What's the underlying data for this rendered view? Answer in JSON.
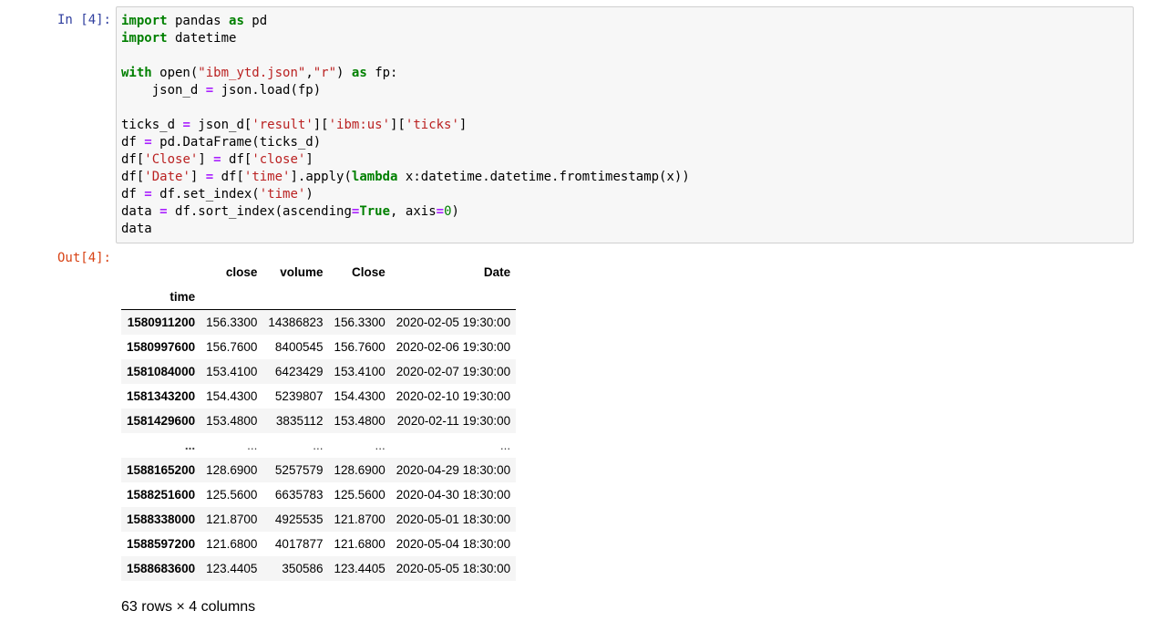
{
  "input_cell": {
    "prompt": "In [4]:",
    "code_lines": [
      [
        {
          "t": "import",
          "c": "kw"
        },
        {
          "t": " pandas ",
          "c": "n"
        },
        {
          "t": "as",
          "c": "kw"
        },
        {
          "t": " pd",
          "c": "n"
        }
      ],
      [
        {
          "t": "import",
          "c": "kw"
        },
        {
          "t": " datetime",
          "c": "n"
        }
      ],
      [],
      [
        {
          "t": "with",
          "c": "kw"
        },
        {
          "t": " open(",
          "c": "n"
        },
        {
          "t": "\"ibm_ytd.json\"",
          "c": "st"
        },
        {
          "t": ",",
          "c": "n"
        },
        {
          "t": "\"r\"",
          "c": "st"
        },
        {
          "t": ") ",
          "c": "n"
        },
        {
          "t": "as",
          "c": "kw"
        },
        {
          "t": " fp:",
          "c": "n"
        }
      ],
      [
        {
          "t": "    json_d ",
          "c": "n"
        },
        {
          "t": "=",
          "c": "op"
        },
        {
          "t": " json.load(fp)",
          "c": "n"
        }
      ],
      [],
      [
        {
          "t": "ticks_d ",
          "c": "n"
        },
        {
          "t": "=",
          "c": "op"
        },
        {
          "t": " json_d[",
          "c": "n"
        },
        {
          "t": "'result'",
          "c": "st"
        },
        {
          "t": "][",
          "c": "n"
        },
        {
          "t": "'ibm:us'",
          "c": "st"
        },
        {
          "t": "][",
          "c": "n"
        },
        {
          "t": "'ticks'",
          "c": "st"
        },
        {
          "t": "]",
          "c": "n"
        }
      ],
      [
        {
          "t": "df ",
          "c": "n"
        },
        {
          "t": "=",
          "c": "op"
        },
        {
          "t": " pd.DataFrame(ticks_d)",
          "c": "n"
        }
      ],
      [
        {
          "t": "df[",
          "c": "n"
        },
        {
          "t": "'Close'",
          "c": "st"
        },
        {
          "t": "] ",
          "c": "n"
        },
        {
          "t": "=",
          "c": "op"
        },
        {
          "t": " df[",
          "c": "n"
        },
        {
          "t": "'close'",
          "c": "st"
        },
        {
          "t": "]",
          "c": "n"
        }
      ],
      [
        {
          "t": "df[",
          "c": "n"
        },
        {
          "t": "'Date'",
          "c": "st"
        },
        {
          "t": "] ",
          "c": "n"
        },
        {
          "t": "=",
          "c": "op"
        },
        {
          "t": " df[",
          "c": "n"
        },
        {
          "t": "'time'",
          "c": "st"
        },
        {
          "t": "].apply(",
          "c": "n"
        },
        {
          "t": "lambda",
          "c": "kw"
        },
        {
          "t": " x:datetime.datetime.fromtimestamp(x))",
          "c": "n"
        }
      ],
      [
        {
          "t": "df ",
          "c": "n"
        },
        {
          "t": "=",
          "c": "op"
        },
        {
          "t": " df.set_index(",
          "c": "n"
        },
        {
          "t": "'time'",
          "c": "st"
        },
        {
          "t": ")",
          "c": "n"
        }
      ],
      [
        {
          "t": "data ",
          "c": "n"
        },
        {
          "t": "=",
          "c": "op"
        },
        {
          "t": " df.sort_index(ascending",
          "c": "n"
        },
        {
          "t": "=",
          "c": "op"
        },
        {
          "t": "True",
          "c": "kw"
        },
        {
          "t": ", axis",
          "c": "n"
        },
        {
          "t": "=",
          "c": "op"
        },
        {
          "t": "0",
          "c": "nu"
        },
        {
          "t": ")",
          "c": "n"
        }
      ],
      [
        {
          "t": "data",
          "c": "n"
        }
      ]
    ]
  },
  "output_cell": {
    "prompt": "Out[4]:",
    "table": {
      "columns": [
        "close",
        "volume",
        "Close",
        "Date"
      ],
      "index_name": "time",
      "rows": [
        {
          "index": "1580911200",
          "cells": [
            "156.3300",
            "14386823",
            "156.3300",
            "2020-02-05 19:30:00"
          ]
        },
        {
          "index": "1580997600",
          "cells": [
            "156.7600",
            "8400545",
            "156.7600",
            "2020-02-06 19:30:00"
          ]
        },
        {
          "index": "1581084000",
          "cells": [
            "153.4100",
            "6423429",
            "153.4100",
            "2020-02-07 19:30:00"
          ]
        },
        {
          "index": "1581343200",
          "cells": [
            "154.4300",
            "5239807",
            "154.4300",
            "2020-02-10 19:30:00"
          ]
        },
        {
          "index": "1581429600",
          "cells": [
            "153.4800",
            "3835112",
            "153.4800",
            "2020-02-11 19:30:00"
          ]
        },
        {
          "index": "...",
          "cells": [
            "...",
            "...",
            "...",
            "..."
          ]
        },
        {
          "index": "1588165200",
          "cells": [
            "128.6900",
            "5257579",
            "128.6900",
            "2020-04-29 18:30:00"
          ]
        },
        {
          "index": "1588251600",
          "cells": [
            "125.5600",
            "6635783",
            "125.5600",
            "2020-04-30 18:30:00"
          ]
        },
        {
          "index": "1588338000",
          "cells": [
            "121.8700",
            "4925535",
            "121.8700",
            "2020-05-01 18:30:00"
          ]
        },
        {
          "index": "1588597200",
          "cells": [
            "121.6800",
            "4017877",
            "121.6800",
            "2020-05-04 18:30:00"
          ]
        },
        {
          "index": "1588683600",
          "cells": [
            "123.4405",
            "350586",
            "123.4405",
            "2020-05-05 18:30:00"
          ]
        }
      ]
    },
    "summary": "63 rows × 4 columns"
  }
}
